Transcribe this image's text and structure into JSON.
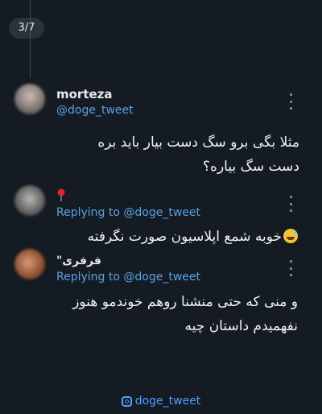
{
  "gallery": {
    "counter": "3/7"
  },
  "tweet": {
    "name": "morteza",
    "handle": "@doge_tweet",
    "text_line1": "مثلا بگی برو سگ دست بیار باید بره",
    "text_line2": "دست سگ بیاره؟"
  },
  "replies": [
    {
      "name": "",
      "pin_icon": "red-pin-icon",
      "replying_to": "Replying to @doge_tweet",
      "text": "خوبه شمع اپلاسیون صورت نگرفته",
      "emoji": "grinning-sweat-emoji"
    },
    {
      "name": "فرفری\"",
      "replying_to": "Replying to @doge_tweet",
      "text_line1": "و منی که حتی منشنا روهم خوندمو هنوز",
      "text_line2": "نفهمیدم داستان چیه"
    }
  ],
  "footer": {
    "instagram_handle": "doge_tweet",
    "icon": "instagram-icon"
  },
  "colors": {
    "link": "#5aa2e4",
    "background": "#141b23"
  }
}
